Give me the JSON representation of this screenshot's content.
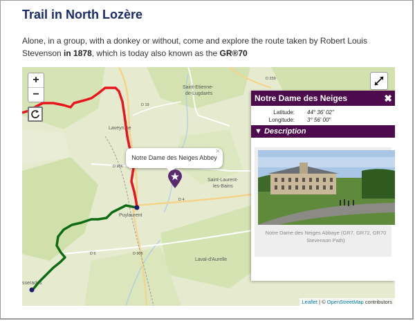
{
  "page": {
    "title": "Trail in North Lozère",
    "intro_1": "Alone, in a group, with a donkey or without, come and explore the route taken by Robert Louis Stevenson ",
    "intro_bold_1": "in 1878",
    "intro_2": ", which is today also known as the ",
    "intro_bold_2": "GR®70"
  },
  "map": {
    "zoom_in": "+",
    "zoom_out": "−",
    "places": {
      "saint_etienne_1": "Saint-Etienne-",
      "saint_etienne_2": "de-Lugdarès",
      "laveyrune": "Laveyrune",
      "saint_laurent_1": "Saint-Laurent-",
      "saint_laurent_2": "les-Bains",
      "puylaurent": "Puylaurent",
      "laval": "Laval-d'Aurelle",
      "sserades": "sserades"
    },
    "roads": {
      "d239": "D 239",
      "d19": "D 19",
      "d906a": "D 906",
      "d4": "D 4",
      "d6": "D 6",
      "d906b": "D 906"
    },
    "popup_text": "Notre Dame des Neiges Abbey",
    "popup_close": "×",
    "attribution_leaflet": "Leaflet",
    "attribution_sep": " | © ",
    "attribution_osm": "OpenStreetMap",
    "attribution_tail": " contributors",
    "colors": {
      "trail_red": "#e8141e",
      "trail_green": "#0f6b13",
      "accent": "#4d0a4d"
    }
  },
  "panel": {
    "title": "Notre Dame des Neiges",
    "close": "✖",
    "latitude_label": "Latitude:",
    "latitude_value": "44° 36' 02\"",
    "longitude_label": "Longitude:",
    "longitude_value": "3° 56' 00\"",
    "description_label": "▼ Description",
    "caption": "Notre Dame des Neiges  Abbaye (GR7, GR72, GR70 Stevenson Path)"
  }
}
